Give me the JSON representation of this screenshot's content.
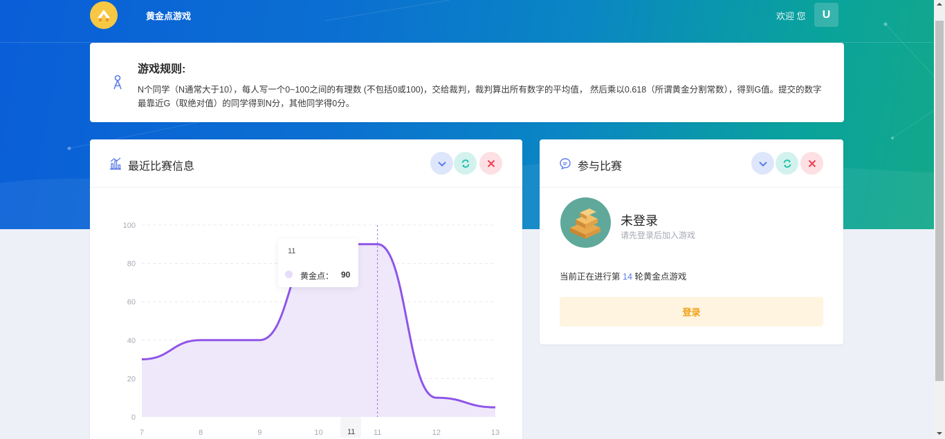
{
  "header": {
    "brand": "黄金点游戏",
    "welcome": "欢迎 您",
    "user_initial": "U"
  },
  "rules": {
    "title": "游戏规则:",
    "text": "N个同学（N通常大于10），每人写一个0~100之间的有理数 (不包括0或100)，交给裁判，裁判算出所有数字的平均值， 然后乘以0.618（所谓黄金分割常数），得到G值。提交的数字最靠近G（取绝对值）的同学得到N分，其他同学得0分。"
  },
  "recent": {
    "title": "最近比赛信息",
    "tooltip": {
      "title": "11",
      "label": "黄金点：",
      "value": "90"
    },
    "axis_pointer_label": "11"
  },
  "join": {
    "title": "参与比赛",
    "status_title": "未登录",
    "status_sub": "请先登录后加入游戏",
    "round_prefix": "当前正在进行第",
    "round_number": "14",
    "round_suffix": "轮黄金点游戏",
    "login_label": "登录"
  },
  "colors": {
    "line": "#8e55e8",
    "area": "#ede5fb",
    "login_bg": "#fff4df",
    "login_text": "#f0a21a"
  },
  "chart_data": {
    "type": "area",
    "x": [
      "7",
      "8",
      "9",
      "10",
      "11",
      "12",
      "13"
    ],
    "y_ticks": [
      "0",
      "20",
      "40",
      "60",
      "80",
      "100"
    ],
    "ylim": [
      0,
      100
    ],
    "series": [
      {
        "name": "黄金点",
        "values": [
          30,
          40,
          40,
          90,
          90,
          10,
          5
        ]
      }
    ],
    "grid": true,
    "smooth": true
  }
}
